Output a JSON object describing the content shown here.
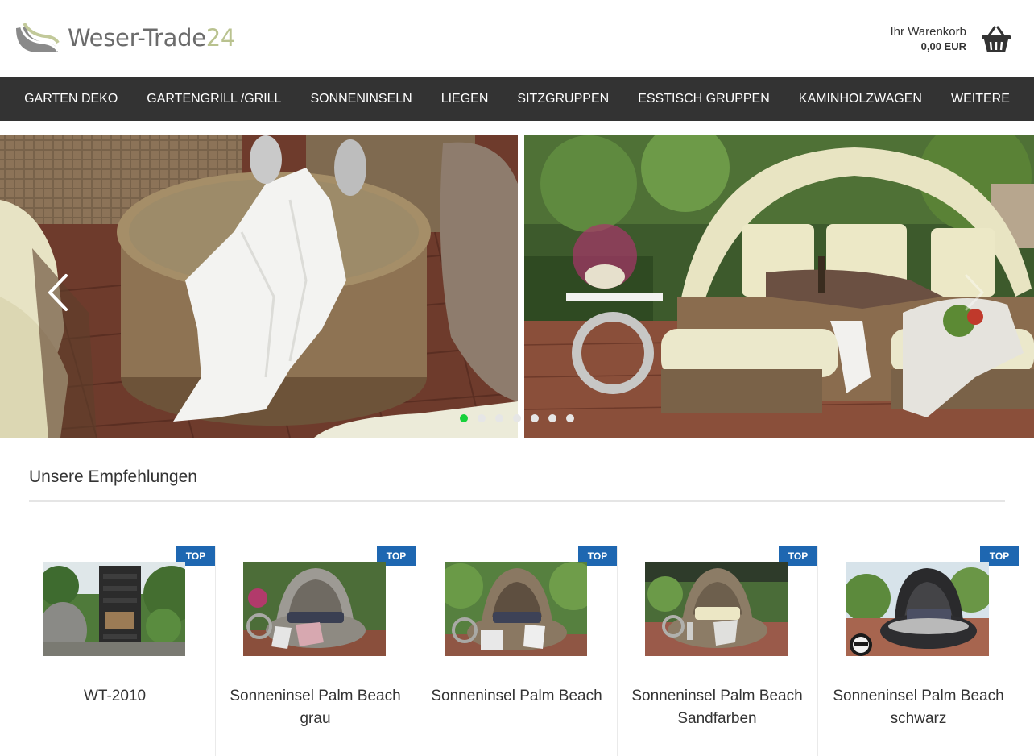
{
  "logo": {
    "text_main": "Weser-Trade",
    "text_num": "24"
  },
  "cart": {
    "label": "Ihr Warenkorb",
    "amount": "0,00 EUR",
    "icon": "basket-icon"
  },
  "nav": {
    "items": [
      {
        "label": "GARTEN DEKO"
      },
      {
        "label": "GARTENGRILL /GRILL"
      },
      {
        "label": "SONNENINSELN"
      },
      {
        "label": "LIEGEN"
      },
      {
        "label": "SITZGRUPPEN"
      },
      {
        "label": "ESSTISCH GRUPPEN"
      },
      {
        "label": "KAMINHOLZWAGEN"
      },
      {
        "label": "WEITERE"
      }
    ]
  },
  "slider": {
    "dots": 7,
    "active_dot": 1,
    "prev_icon": "chevron-left-icon",
    "next_icon": "chevron-right-icon"
  },
  "recommendations": {
    "title": "Unsere Empfehlungen",
    "products": [
      {
        "badge": "TOP",
        "name": "WT-2010"
      },
      {
        "badge": "TOP",
        "name": "Sonneninsel Palm Beach grau"
      },
      {
        "badge": "TOP",
        "name": "Sonneninsel Palm Beach"
      },
      {
        "badge": "TOP",
        "name": "Sonneninsel Palm Beach Sandfarben"
      },
      {
        "badge": "TOP",
        "name": "Sonneninsel Palm Beach schwarz"
      }
    ]
  },
  "colors": {
    "nav_bg": "#333333",
    "badge_bg": "#1e67b1",
    "active_dot": "#17d13b",
    "logo_accent": "#b9c28f"
  }
}
